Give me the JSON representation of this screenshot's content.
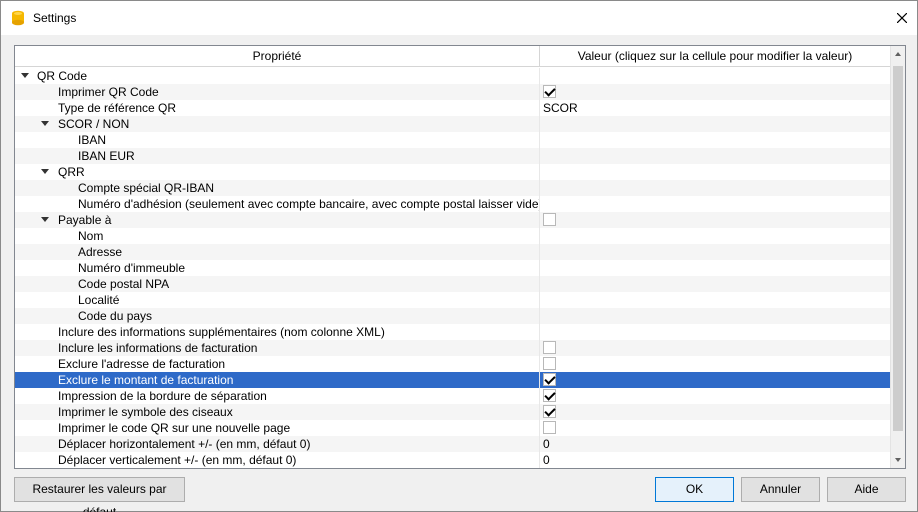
{
  "window": {
    "title": "Settings"
  },
  "table": {
    "header": {
      "property": "Propriété",
      "value": "Valeur (cliquez sur la cellule pour modifier la valeur)"
    },
    "rows": [
      {
        "level": 0,
        "expandable": true,
        "label": "QR Code",
        "value_type": "none"
      },
      {
        "level": 1,
        "expandable": false,
        "label": "Imprimer QR Code",
        "value_type": "checkbox",
        "checked": true
      },
      {
        "level": 1,
        "expandable": false,
        "label": "Type de référence QR",
        "value_type": "text",
        "value": "SCOR"
      },
      {
        "level": 1,
        "expandable": true,
        "label": "SCOR / NON",
        "value_type": "none"
      },
      {
        "level": 2,
        "expandable": false,
        "label": "IBAN",
        "value_type": "none"
      },
      {
        "level": 2,
        "expandable": false,
        "label": "IBAN EUR",
        "value_type": "none"
      },
      {
        "level": 1,
        "expandable": true,
        "label": "QRR",
        "value_type": "none"
      },
      {
        "level": 2,
        "expandable": false,
        "label": "Compte spécial QR-IBAN",
        "value_type": "none"
      },
      {
        "level": 2,
        "expandable": false,
        "label": "Numéro d'adhésion (seulement avec compte bancaire, avec compte postal laisser vide)",
        "value_type": "none"
      },
      {
        "level": 1,
        "expandable": true,
        "label": "Payable à",
        "value_type": "checkbox",
        "checked": false
      },
      {
        "level": 2,
        "expandable": false,
        "label": "Nom",
        "value_type": "none"
      },
      {
        "level": 2,
        "expandable": false,
        "label": "Adresse",
        "value_type": "none"
      },
      {
        "level": 2,
        "expandable": false,
        "label": "Numéro d'immeuble",
        "value_type": "none"
      },
      {
        "level": 2,
        "expandable": false,
        "label": "Code postal NPA",
        "value_type": "none"
      },
      {
        "level": 2,
        "expandable": false,
        "label": "Localité",
        "value_type": "none"
      },
      {
        "level": 2,
        "expandable": false,
        "label": "Code du pays",
        "value_type": "none"
      },
      {
        "level": 1,
        "expandable": false,
        "label": "Inclure des informations supplémentaires (nom colonne XML)",
        "value_type": "none"
      },
      {
        "level": 1,
        "expandable": false,
        "label": "Inclure les informations de facturation",
        "value_type": "checkbox",
        "checked": false
      },
      {
        "level": 1,
        "expandable": false,
        "label": "Exclure l'adresse de facturation",
        "value_type": "checkbox",
        "checked": false
      },
      {
        "level": 1,
        "expandable": false,
        "label": "Exclure le montant de facturation",
        "value_type": "checkbox",
        "checked": true,
        "selected": true
      },
      {
        "level": 1,
        "expandable": false,
        "label": "Impression de la bordure de séparation",
        "value_type": "checkbox",
        "checked": true
      },
      {
        "level": 1,
        "expandable": false,
        "label": "Imprimer le symbole des ciseaux",
        "value_type": "checkbox",
        "checked": true
      },
      {
        "level": 1,
        "expandable": false,
        "label": "Imprimer le code QR sur une nouvelle page",
        "value_type": "checkbox",
        "checked": false
      },
      {
        "level": 1,
        "expandable": false,
        "label": "Déplacer horizontalement +/- (en mm, défaut 0)",
        "value_type": "text",
        "value": "0"
      },
      {
        "level": 1,
        "expandable": false,
        "label": "Déplacer verticalement +/- (en mm, défaut 0)",
        "value_type": "text",
        "value": "0"
      }
    ]
  },
  "buttons": {
    "restore": "Restaurer les valeurs par défaut",
    "ok": "OK",
    "cancel": "Annuler",
    "help": "Aide"
  },
  "colors": {
    "selection": "#2e6ac8",
    "app_icon": "#f5b800"
  }
}
